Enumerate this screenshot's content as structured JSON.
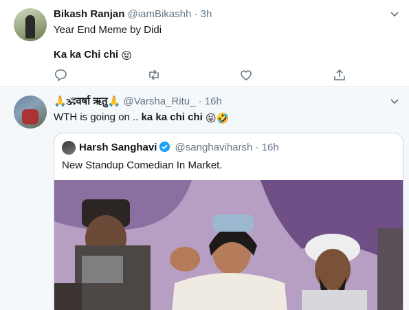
{
  "tweets": [
    {
      "name": "Bikash Ranjan",
      "handle": "@iamBikashh",
      "separator": "·",
      "time": "3h",
      "line1": "Year End Meme by Didi",
      "line2": "Ka ka Chi chi",
      "line2_emoji": "😝"
    },
    {
      "name_prefix_emoji": "🙏🕉",
      "name": "वर्षा ऋतु",
      "name_suffix_emoji": "🙏",
      "handle": "@Varsha_Ritu_",
      "separator": "·",
      "time": "16h",
      "line_prefix": "WTH is going on .. ",
      "line_bold": "ka ka chi chi",
      "line_emoji": "😜🤣",
      "quote": {
        "name": "Harsh Sanghavi",
        "handle": "@sanghaviharsh",
        "separator": "·",
        "time": "16h",
        "text": "New Standup Comedian In Market."
      }
    }
  ],
  "icons": {
    "reply": "reply-icon",
    "retweet": "retweet-icon",
    "like": "heart-icon",
    "share": "share-icon",
    "more": "chevron-down-icon",
    "verified": "verified-badge-icon"
  },
  "colors": {
    "text": "#14171a",
    "secondary": "#657786",
    "verified": "#1da1f2",
    "border": "#e6ecf0"
  }
}
